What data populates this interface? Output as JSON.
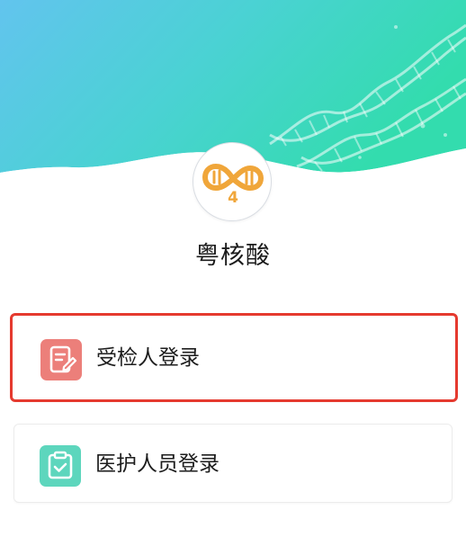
{
  "app": {
    "title": "粤核酸",
    "logo_number": "4"
  },
  "login_options": [
    {
      "label": "受检人登录",
      "icon": "form-edit-icon",
      "color": "#ec7f7a",
      "highlighted": true
    },
    {
      "label": "医护人员登录",
      "icon": "clipboard-check-icon",
      "color": "#5dd6bd",
      "highlighted": false
    }
  ],
  "colors": {
    "header_gradient_start": "#5ec8ec",
    "header_gradient_end": "#35dbb0",
    "logo_orange": "#f0a63a",
    "highlight_border": "#e53a2f"
  }
}
